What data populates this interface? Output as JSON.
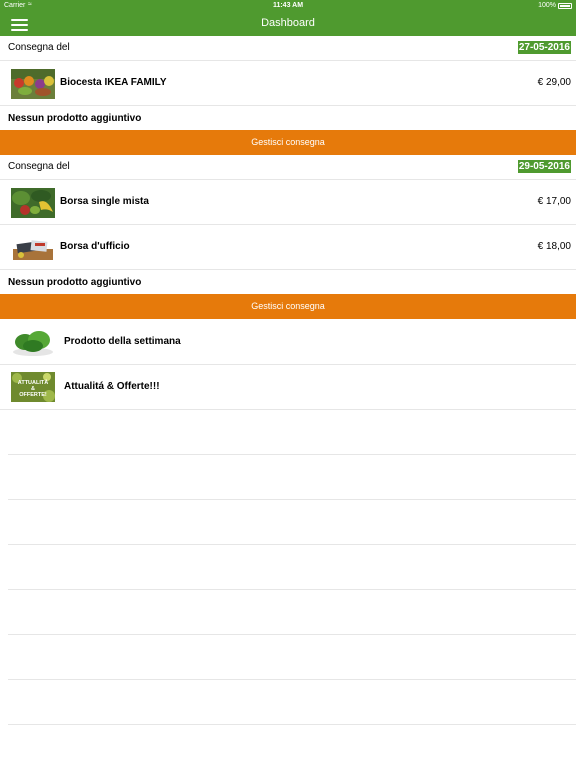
{
  "status_bar": {
    "carrier": "Carrier",
    "time": "11:43 AM",
    "battery": "100%"
  },
  "nav": {
    "title": "Dashboard"
  },
  "deliveries": [
    {
      "label": "Consegna del",
      "date": "27-05-2016",
      "items": [
        {
          "name": "Biocesta IKEA FAMILY",
          "price": "€ 29,00",
          "icon": "veg-basket-image"
        }
      ],
      "extra": "Nessun prodotto aggiuntivo",
      "button": "Gestisci consegna"
    },
    {
      "label": "Consegna del",
      "date": "29-05-2016",
      "items": [
        {
          "name": "Borsa single mista",
          "price": "€ 17,00",
          "icon": "mixed-bag-image"
        },
        {
          "name": "Borsa d'ufficio",
          "price": "€ 18,00",
          "icon": "office-bag-image"
        }
      ],
      "extra": "Nessun prodotto aggiuntivo",
      "button": "Gestisci consegna"
    }
  ],
  "menu_items": [
    {
      "name": "Prodotto della settimana",
      "icon": "spinach-image"
    },
    {
      "name": "Attualitá & Offerte!!!",
      "icon": "offers-image",
      "image_text": "ATTUALITÀ & OFFERTE!"
    }
  ],
  "colors": {
    "green": "#4f9a2f",
    "orange": "#e67a0b"
  }
}
